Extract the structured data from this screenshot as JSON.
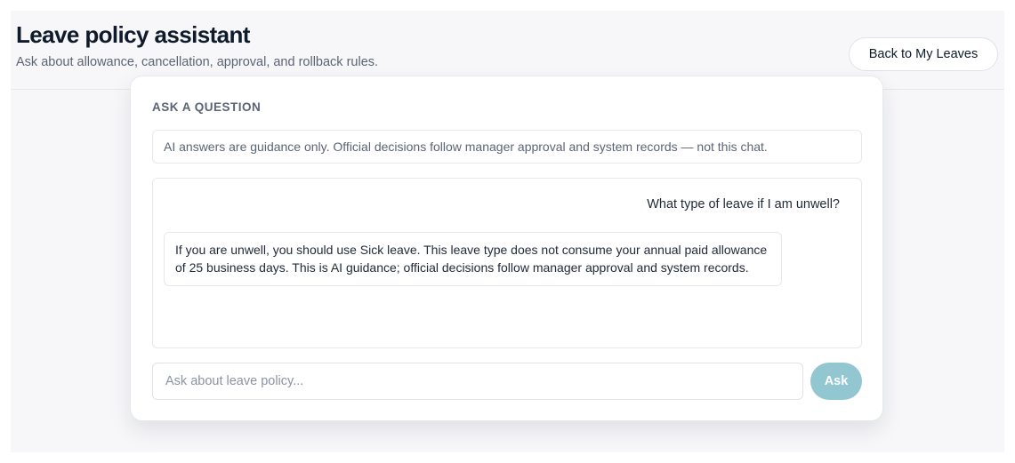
{
  "header": {
    "title": "Leave policy assistant",
    "subtitle": "Ask about allowance, cancellation, approval, and rollback rules.",
    "back_button_label": "Back to My Leaves"
  },
  "card": {
    "section_label": "ASK A QUESTION",
    "disclaimer": "AI answers are guidance only. Official decisions follow manager approval and system records — not this chat."
  },
  "chat": {
    "messages": [
      {
        "role": "user",
        "text": "What type of leave if I am unwell?"
      },
      {
        "role": "assistant",
        "text": "If you are unwell, you should use Sick leave. This leave type does not consume your annual paid allowance of 25 business days. This is AI guidance; official decisions follow manager approval and system records."
      }
    ]
  },
  "input": {
    "placeholder": "Ask about leave policy...",
    "value": "",
    "ask_button_label": "Ask"
  },
  "colors": {
    "accent": "#92c7d1",
    "title": "#0f1a2b",
    "muted": "#5b6475"
  }
}
